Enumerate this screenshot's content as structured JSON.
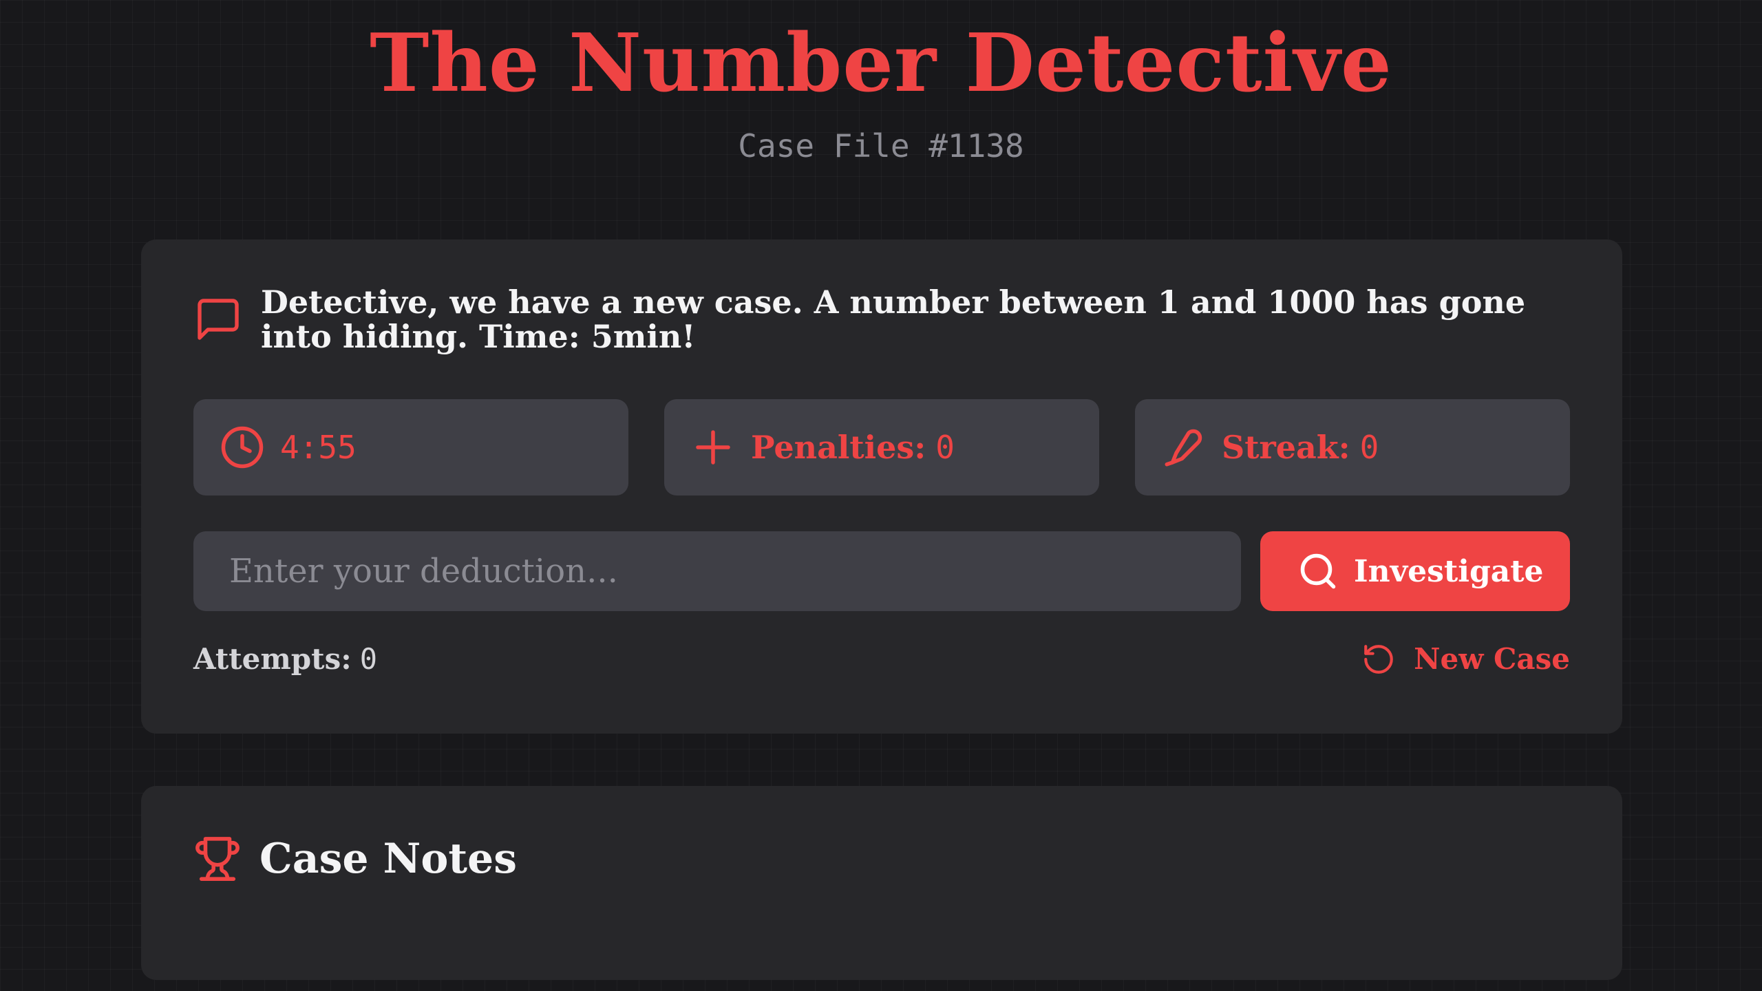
{
  "header": {
    "title": "The Number Detective",
    "subtitle": "Case File #1138"
  },
  "briefing": {
    "icon": "message-square-icon",
    "text": "Detective, we have a new case. A number between 1 and 1000 has gone into hiding. Time: 5min!"
  },
  "stats": {
    "timer": {
      "icon": "clock-icon",
      "value": "4:55"
    },
    "penalties": {
      "icon": "plus-icon",
      "label": "Penalties:",
      "value": "0"
    },
    "streak": {
      "icon": "pipette-icon",
      "label": "Streak:",
      "value": "0"
    }
  },
  "guess": {
    "placeholder": "Enter your deduction...",
    "value": ""
  },
  "investigate_button": {
    "icon": "search-icon",
    "label": "Investigate"
  },
  "attempts": {
    "label": "Attempts:",
    "value": "0"
  },
  "new_case_button": {
    "icon": "rotate-ccw-icon",
    "label": "New Case"
  },
  "notes": {
    "icon": "trophy-icon",
    "title": "Case Notes"
  },
  "colors": {
    "accent": "#ef4444",
    "background": "#18181b",
    "card": "#27272a",
    "field": "#3f3f46",
    "muted": "#8b8b93"
  }
}
